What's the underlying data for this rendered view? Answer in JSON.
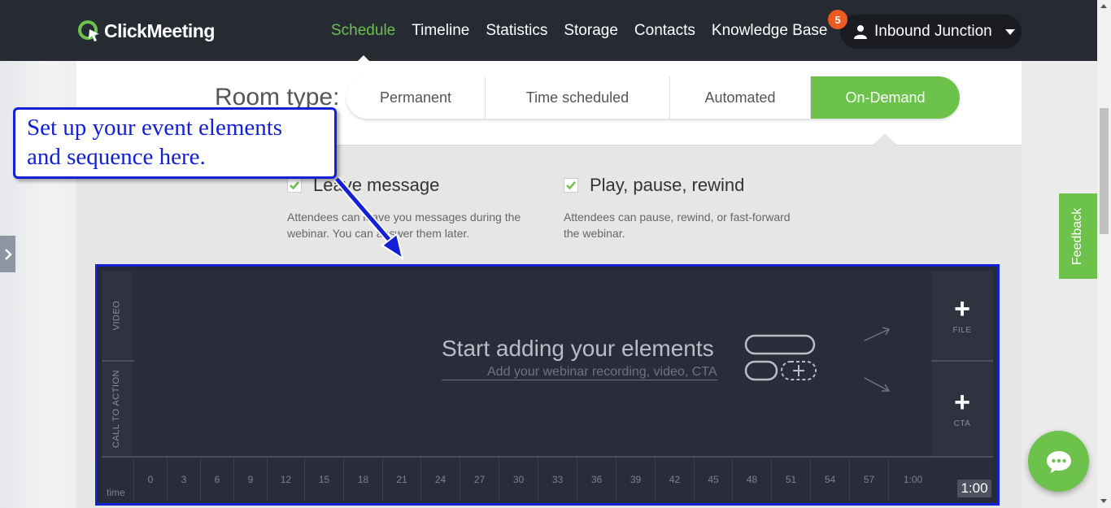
{
  "brand": {
    "name": "ClickMeeting",
    "accent": "#6cc24a",
    "nav_bg": "#262a33"
  },
  "nav": {
    "items": [
      {
        "label": "Schedule",
        "active": true
      },
      {
        "label": "Timeline",
        "active": false
      },
      {
        "label": "Statistics",
        "active": false
      },
      {
        "label": "Storage",
        "active": false
      },
      {
        "label": "Contacts",
        "active": false
      },
      {
        "label": "Knowledge Base",
        "active": false
      }
    ],
    "notification_count": "5",
    "account_name": "Inbound Junction"
  },
  "room_type": {
    "label": "Room type:",
    "tabs": [
      {
        "label": "Permanent",
        "selected": false
      },
      {
        "label": "Time scheduled",
        "selected": false
      },
      {
        "label": "Automated",
        "selected": false
      },
      {
        "label": "On-Demand",
        "selected": true
      }
    ]
  },
  "options": [
    {
      "title": "Leave message",
      "checked": true,
      "description": "Attendees can leave you messages during the webinar. You can answer them later."
    },
    {
      "title": "Play, pause, rewind",
      "checked": true,
      "description": "Attendees can pause, rewind, or fast-forward the webinar."
    }
  ],
  "editor": {
    "lanes": {
      "video": "VIDEO",
      "cta": "CALL TO ACTION",
      "time": "time"
    },
    "empty_title": "Start adding your elements",
    "empty_subtitle": "Add your webinar recording, video, CTA",
    "add_file_label": "FILE",
    "add_cta_label": "CTA",
    "plus": "+",
    "ticks": [
      "0",
      "3",
      "6",
      "9",
      "12",
      "15",
      "18",
      "21",
      "24",
      "27",
      "30",
      "33",
      "36",
      "39",
      "42",
      "45",
      "48",
      "51",
      "54",
      "57",
      "1:00"
    ],
    "duration": "1:00"
  },
  "callout": {
    "text_line1": "Set up your event elements",
    "text_line2": "and sequence here."
  },
  "feedback_label": "Feedback"
}
